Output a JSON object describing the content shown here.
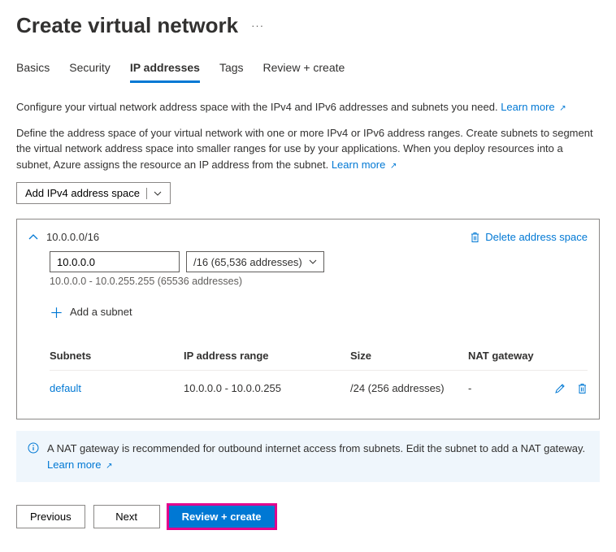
{
  "header": {
    "title": "Create virtual network",
    "more": "···"
  },
  "tabs": {
    "basics": "Basics",
    "security": "Security",
    "ip": "IP addresses",
    "tags": "Tags",
    "review": "Review + create"
  },
  "desc1": "Configure your virtual network address space with the IPv4 and IPv6 addresses and subnets you need. ",
  "desc2": "Define the address space of your virtual network with one or more IPv4 or IPv6 address ranges. Create subnets to segment the virtual network address space into smaller ranges for use by your applications. When you deploy resources into a subnet, Azure assigns the resource an IP address from the subnet. ",
  "learn_more": "Learn more",
  "add_space_btn": "Add IPv4 address space",
  "space": {
    "cidr": "10.0.0.0/16",
    "delete_label": "Delete address space",
    "ip_input": "10.0.0.0",
    "prefix_select": "/16 (65,536 addresses)",
    "range_text": "10.0.0.0 - 10.0.255.255 (65536 addresses)",
    "add_subnet": "Add a subnet"
  },
  "table": {
    "headers": {
      "subnets": "Subnets",
      "range": "IP address range",
      "size": "Size",
      "nat": "NAT gateway"
    },
    "rows": [
      {
        "name": "default",
        "range": "10.0.0.0 - 10.0.0.255",
        "size": "/24 (256 addresses)",
        "nat": "-"
      }
    ]
  },
  "info": {
    "text": "A NAT gateway is recommended for outbound internet access from subnets. Edit the subnet to add a NAT gateway. ",
    "learn": "Learn more"
  },
  "footer": {
    "previous": "Previous",
    "next": "Next",
    "review": "Review + create"
  }
}
